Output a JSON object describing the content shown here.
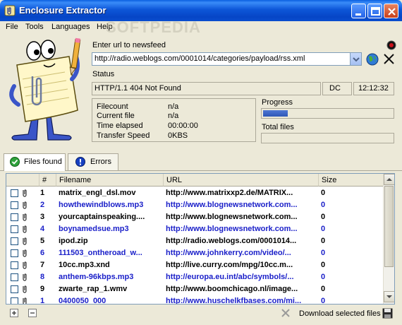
{
  "window": {
    "title": "Enclosure Extractor",
    "watermark": "SOFTPEDIA"
  },
  "menu": [
    "File",
    "Tools",
    "Languages",
    "Help"
  ],
  "url_section": {
    "label": "Enter url to newsfeed",
    "value": "http://radio.weblogs.com/0001014/categories/payload/rss.xml"
  },
  "status": {
    "label": "Status",
    "text": "HTTP/1.1 404 Not Found",
    "code": "DC",
    "time": "12:12:32"
  },
  "info": [
    {
      "label": "Filecount",
      "value": "n/a"
    },
    {
      "label": "Current file",
      "value": "n/a"
    },
    {
      "label": "Time elapsed",
      "value": "00:00:00"
    },
    {
      "label": "Transfer Speed",
      "value": "0KBS"
    }
  ],
  "progress": {
    "label": "Progress",
    "fraction": 0.19
  },
  "total_files": {
    "label": "Total files",
    "fraction": 0
  },
  "tabs": [
    "Files found",
    "Errors"
  ],
  "columns": [
    "#",
    "Filename",
    "URL",
    "Size"
  ],
  "rows": [
    {
      "num": "1",
      "filename": "matrix_engl_dsl.mov",
      "url": "http://www.matrixxp2.de/MATRIX...",
      "size": "0",
      "color": "#000000"
    },
    {
      "num": "2",
      "filename": "howthewindblows.mp3",
      "url": "http://www.blognewsnetwork.com...",
      "size": "0",
      "color": "#1b20c9"
    },
    {
      "num": "3",
      "filename": "yourcaptainspeaking....",
      "url": "http://www.blognewsnetwork.com...",
      "size": "0",
      "color": "#000000"
    },
    {
      "num": "4",
      "filename": "boynamedsue.mp3",
      "url": "http://www.blognewsnetwork.com...",
      "size": "0",
      "color": "#1b20c9"
    },
    {
      "num": "5",
      "filename": "ipod.zip",
      "url": "http://radio.weblogs.com/0001014...",
      "size": "0",
      "color": "#000000"
    },
    {
      "num": "6",
      "filename": "111503_ontheroad_w...",
      "url": "http://www.johnkerry.com/video/...",
      "size": "0",
      "color": "#1b20c9"
    },
    {
      "num": "7",
      "filename": "10cc.mp3.xnd",
      "url": "http://live.curry.com/mpg/10cc.m...",
      "size": "0",
      "color": "#000000"
    },
    {
      "num": "8",
      "filename": "anthem-96kbps.mp3",
      "url": "http://europa.eu.int/abc/symbols/...",
      "size": "0",
      "color": "#1b20c9"
    },
    {
      "num": "9",
      "filename": "zwarte_rap_1.wmv",
      "url": "http://www.boomchicago.nl/image...",
      "size": "0",
      "color": "#000000"
    },
    {
      "num": "1",
      "filename": "0400050_000",
      "url": "http://www.huschelkfbases.com/mi...",
      "size": "0",
      "color": "#1b20c9"
    }
  ],
  "bottom": {
    "download_label": "Download selected files"
  },
  "icons": {
    "app": "paperclip-icon",
    "record": "record-icon",
    "globe": "globe-icon",
    "cancel": "close-x-icon",
    "ok": "green-check-icon",
    "error": "error-icon",
    "save": "floppy-disk-icon",
    "plus": "plus-icon",
    "minus": "minus-icon"
  }
}
